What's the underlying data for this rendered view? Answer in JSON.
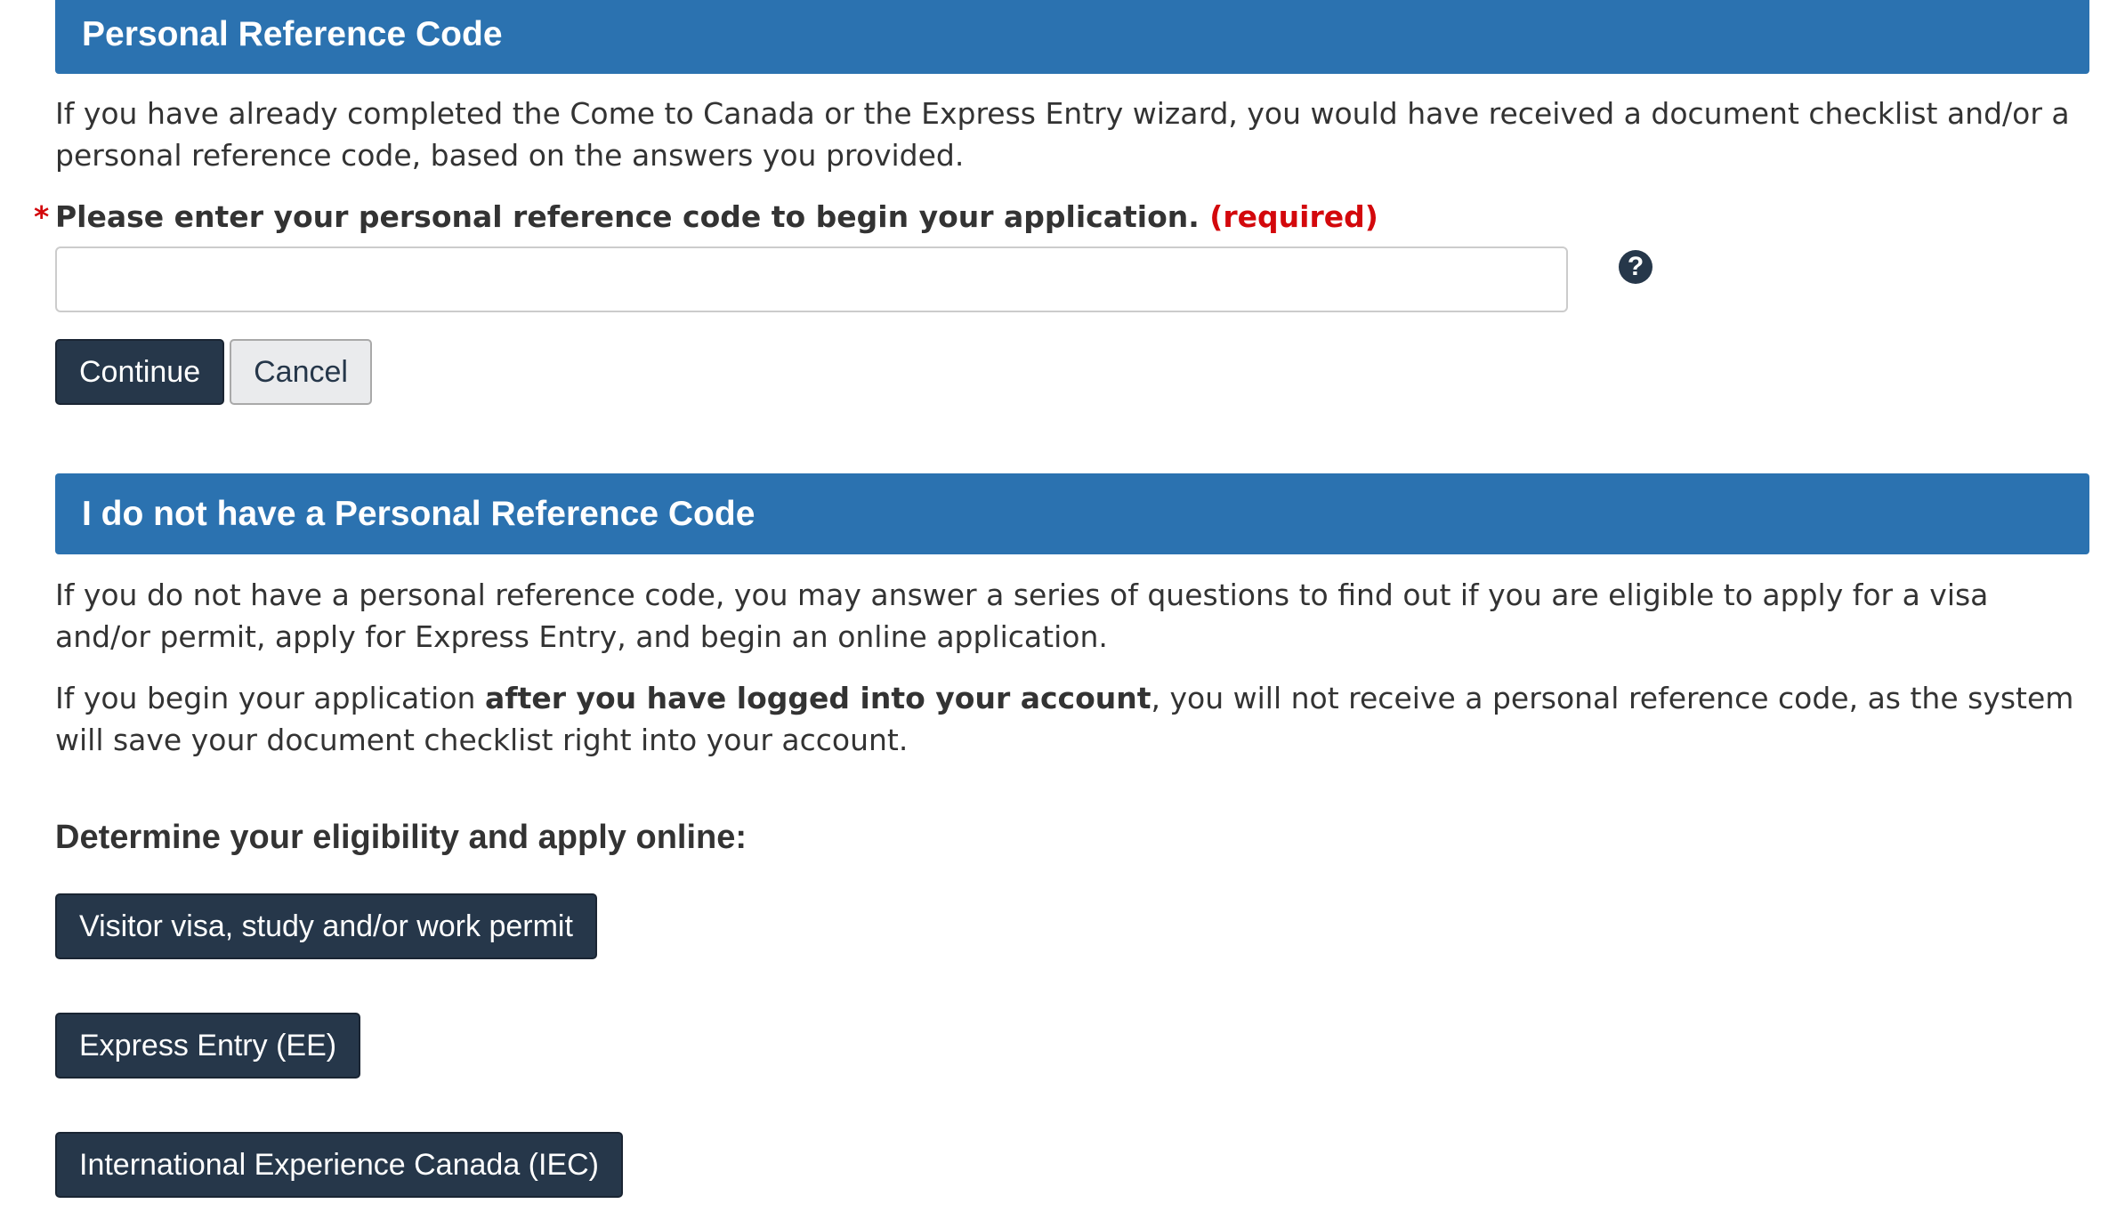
{
  "prc_section": {
    "heading": "Personal Reference Code",
    "intro": "If you have already completed the Come to Canada or the Express Entry wizard, you would have received a document checklist and/or a personal reference code, based on the answers you provided.",
    "field_asterisk": "*",
    "field_label": "Please enter your personal reference code to begin your application.",
    "field_required": "(required)",
    "input_value": "",
    "help_icon": "question-circle-icon",
    "help_glyph": "?",
    "continue_label": "Continue",
    "cancel_label": "Cancel"
  },
  "no_prc_section": {
    "heading": "I do not have a Personal Reference Code",
    "para1": "If you do not have a personal reference code, you may answer a series of questions to find out if you are eligible to apply for a visa and/or permit, apply for Express Entry, and begin an online application.",
    "para2_before": "If you begin your application ",
    "para2_bold": "after you have logged into your account",
    "para2_after": ", you will not receive a personal reference code, as the system will save your document checklist right into your account.",
    "eligibility_heading": "Determine your eligibility and apply online:",
    "buttons": [
      "Visitor visa, study and/or work permit",
      "Express Entry (EE)",
      "International Experience Canada (IEC)"
    ]
  },
  "colors": {
    "panel_heading_bg": "#2b72b0",
    "primary_button_bg": "#26374a",
    "required_red": "#d3080c",
    "default_button_bg": "#eaebed"
  }
}
